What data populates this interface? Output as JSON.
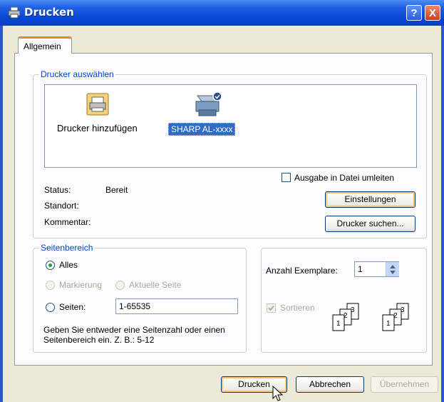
{
  "window": {
    "title": "Drucken",
    "help_label": "?",
    "close_label": "X"
  },
  "tabs": [
    {
      "label": "Allgemein"
    }
  ],
  "printer_group": {
    "legend": "Drucker auswählen",
    "printers": [
      {
        "label": "Drucker hinzufügen",
        "icon": "add-printer-icon"
      },
      {
        "label": "SHARP AL-xxxx",
        "icon": "printer-icon",
        "selected": true
      }
    ],
    "status_label": "Status:",
    "status_value": "Bereit",
    "location_label": "Standort:",
    "comment_label": "Kommentar:",
    "print_to_file_label": "Ausgabe in Datei umleiten",
    "settings_button": "Einstellungen",
    "find_printer_button": "Drucker suchen..."
  },
  "page_range": {
    "legend": "Seitenbereich",
    "all_label": "Alles",
    "selection_label": "Markierung",
    "current_page_label": "Aktuelle Seite",
    "pages_label": "Seiten:",
    "pages_value": "1-65535",
    "hint": "Geben Sie entweder eine Seitenzahl oder einen Seitenbereich ein. Z. B.: 5-12"
  },
  "copies": {
    "count_label": "Anzahl Exemplare:",
    "count_value": "1",
    "collate_label": "Sortieren",
    "collate_pages": [
      "1",
      "2",
      "3"
    ]
  },
  "buttons": {
    "print": "Drucken",
    "cancel": "Abbrechen",
    "apply": "Übernehmen"
  },
  "colors": {
    "titlebar": "#0a46d3",
    "legend_text": "#0046d5",
    "focus_border": "#f4c776"
  }
}
